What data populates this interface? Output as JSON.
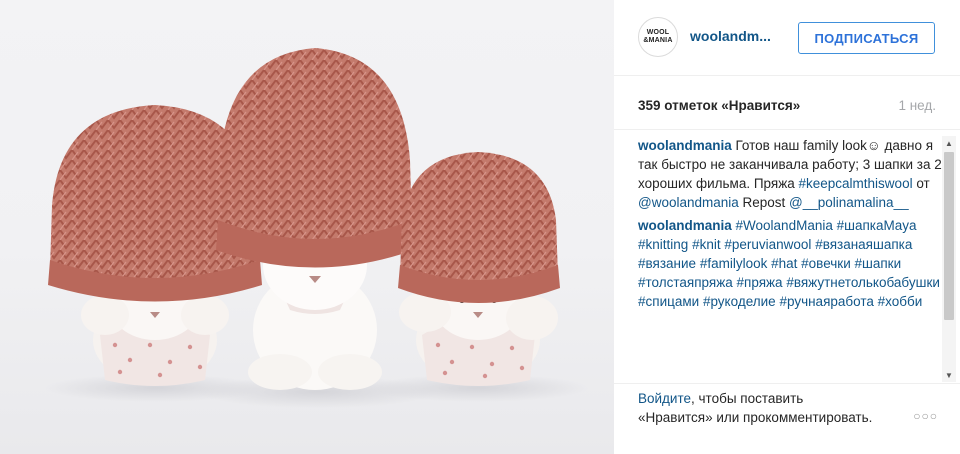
{
  "post": {
    "username": "woolandm...",
    "avatar_text": [
      "WOOL",
      "&MANIA"
    ],
    "follow_label": "ПОДПИСАТЬСЯ",
    "likes": "359 отметок «Нравится»",
    "time": "1 нед.",
    "image": "three-bunnies-in-knit-hats"
  },
  "comments": [
    {
      "user": "woolandmania",
      "parts": [
        {
          "t": " Готов наш family look☺ давно я так быстро не заканчивала работу; 3 шапки за 2 хороших фильма. Пряжа ",
          "tag": false
        },
        {
          "t": "#keepcalmthiswool",
          "tag": true
        },
        {
          "t": " от ",
          "tag": false
        },
        {
          "t": "@woolandmania",
          "tag": true
        },
        {
          "t": " Repost ",
          "tag": false
        },
        {
          "t": "@__polinamalina__",
          "tag": true
        }
      ]
    },
    {
      "user": "woolandmania",
      "parts": [
        {
          "t": " ",
          "tag": false
        },
        {
          "t": "#WoolandMania",
          "tag": true
        },
        {
          "t": " ",
          "tag": false
        },
        {
          "t": "#шапкаMaya",
          "tag": true
        },
        {
          "t": " ",
          "tag": false
        },
        {
          "t": "#knitting",
          "tag": true
        },
        {
          "t": " ",
          "tag": false
        },
        {
          "t": "#knit",
          "tag": true
        },
        {
          "t": " ",
          "tag": false
        },
        {
          "t": "#peruvianwool",
          "tag": true
        },
        {
          "t": " ",
          "tag": false
        },
        {
          "t": "#вязанаяшапка",
          "tag": true
        },
        {
          "t": " ",
          "tag": false
        },
        {
          "t": "#вязание",
          "tag": true
        },
        {
          "t": " ",
          "tag": false
        },
        {
          "t": "#familylook",
          "tag": true
        },
        {
          "t": " ",
          "tag": false
        },
        {
          "t": "#hat",
          "tag": true
        },
        {
          "t": " ",
          "tag": false
        },
        {
          "t": "#овечки",
          "tag": true
        },
        {
          "t": " ",
          "tag": false
        },
        {
          "t": "#шапки",
          "tag": true
        },
        {
          "t": " ",
          "tag": false
        },
        {
          "t": "#толстаяпряжа",
          "tag": true
        },
        {
          "t": " ",
          "tag": false
        },
        {
          "t": "#пряжа",
          "tag": true
        },
        {
          "t": " ",
          "tag": false
        },
        {
          "t": "#вяжутнетолькобабушки",
          "tag": true
        },
        {
          "t": " ",
          "tag": false
        },
        {
          "t": "#спицами",
          "tag": true
        },
        {
          "t": " ",
          "tag": false
        },
        {
          "t": "#рукоделие",
          "tag": true
        },
        {
          "t": " ",
          "tag": false
        },
        {
          "t": "#ручнаяработа",
          "tag": true
        },
        {
          "t": " ",
          "tag": false
        },
        {
          "t": "#хобби",
          "tag": true
        }
      ]
    }
  ],
  "footer": {
    "login_link": "Войдите",
    "login_text": ", чтобы поставить «Нравится» или прокомментировать.",
    "more": "○○○"
  },
  "colors": {
    "link": "#125688",
    "follow": "#2d72d9",
    "hat": "#c47a6c"
  }
}
